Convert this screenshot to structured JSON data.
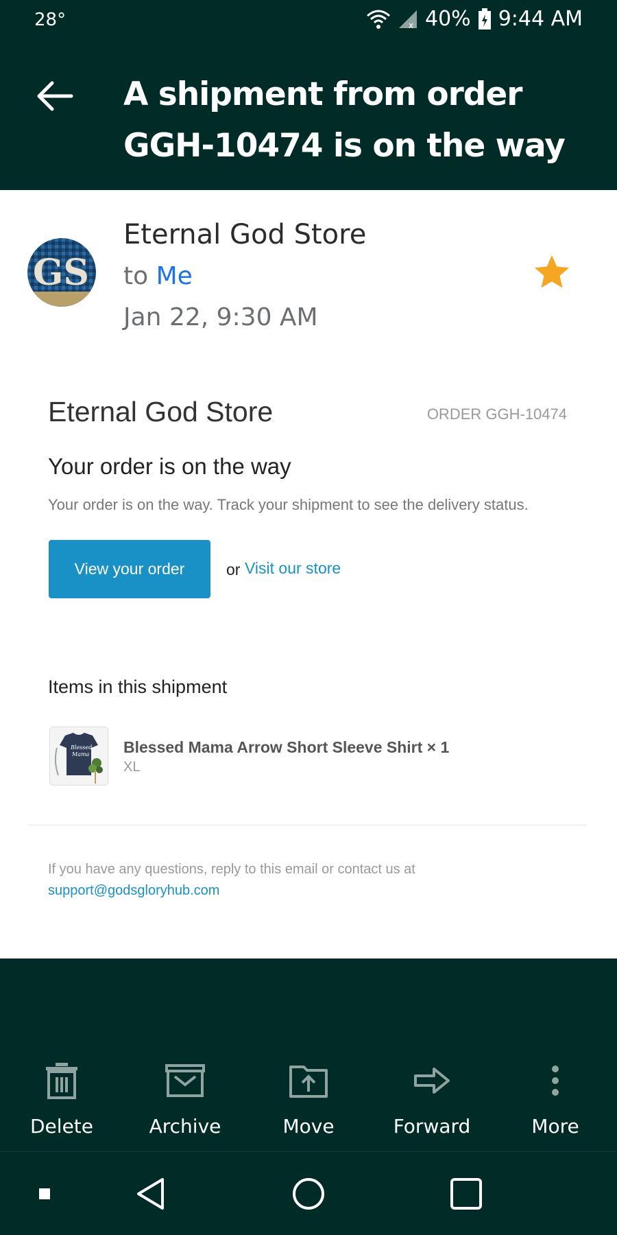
{
  "status": {
    "temperature": "28°",
    "battery": "40%",
    "time": "9:44 AM"
  },
  "header": {
    "subject": "A shipment from order GGH-10474 is on the way"
  },
  "email": {
    "sender": "Eternal God Store",
    "to_prefix": "to",
    "recipient": "Me",
    "date": "Jan 22, 9:30 AM",
    "starred": true,
    "avatar_initials": "GS"
  },
  "body": {
    "store_name": "Eternal God Store",
    "order_number": "ORDER GGH-10474",
    "heading": "Your order is on the way",
    "description": "Your order is on the way. Track your shipment to see the delivery status.",
    "view_button": "View your order",
    "or_text": "or",
    "store_link": "Visit our store",
    "items_heading": "Items in this shipment",
    "items": [
      {
        "title": "Blessed Mama Arrow Short Sleeve Shirt × 1",
        "variant": "XL",
        "thumb_text_1": "Blessed",
        "thumb_text_2": "Mama"
      }
    ],
    "footer_text": "If you have any questions, reply to this email or contact us at",
    "footer_email": "support@godsgloryhub.com"
  },
  "actions": {
    "delete": "Delete",
    "archive": "Archive",
    "move": "Move",
    "forward": "Forward",
    "more": "More"
  },
  "colors": {
    "header_bg": "#012b27",
    "star": "#f5a623",
    "link": "#1990c6",
    "recipient": "#1a73e8"
  }
}
